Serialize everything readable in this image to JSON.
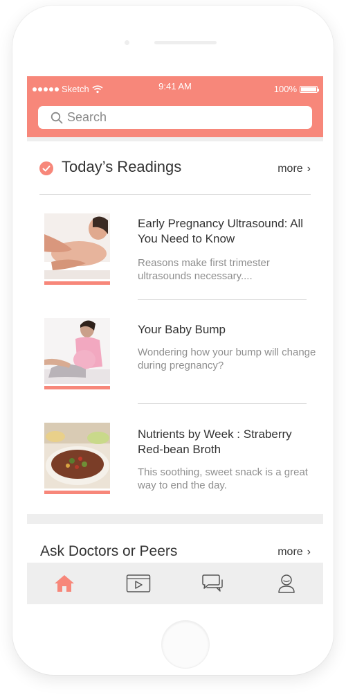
{
  "status_bar": {
    "carrier": "Sketch",
    "time": "9:41 AM",
    "battery": "100%"
  },
  "search": {
    "placeholder": "Search"
  },
  "readings": {
    "title": "Today’s Readings",
    "more_label": "more",
    "articles": [
      {
        "title": "Early Pregnancy Ultrasound: All You Need to Know",
        "description": "Reasons make first trimester ultrasounds necessary...."
      },
      {
        "title": "Your Baby Bump",
        "description": "Wondering how your bump will change during pregnancy?"
      },
      {
        "title": "Nutrients by Week : Straberry Red-bean Broth",
        "description": "This soothing, sweet snack is a great way to end the day."
      }
    ]
  },
  "ask": {
    "title": "Ask Doctors or Peers",
    "more_label": "more"
  },
  "tab_bar": {
    "active_tab": "home",
    "tabs": [
      "home-icon",
      "video-icon",
      "chat-icon",
      "profile-icon"
    ]
  },
  "colors": {
    "accent": "#f7877a",
    "band": "#eeeeee",
    "text": "#333333",
    "muted": "#8f8f8f"
  }
}
